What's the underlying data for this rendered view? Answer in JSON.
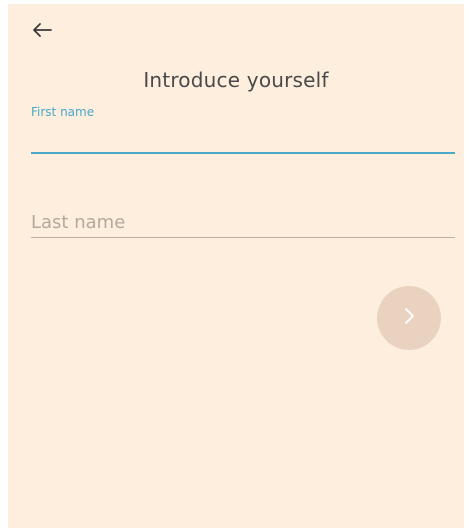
{
  "header": {
    "back_icon": "arrow-left-icon",
    "title": "Introduce yourself"
  },
  "form": {
    "first_name": {
      "label": "First name",
      "value": "",
      "state": "focused",
      "accent_color": "#4aa8c8"
    },
    "last_name": {
      "placeholder": "Last name",
      "value": ""
    },
    "next_button": {
      "icon": "chevron-right-icon",
      "state": "disabled"
    }
  },
  "colors": {
    "background": "#fdeedd",
    "next_button_disabled": "#e9d3c0"
  }
}
